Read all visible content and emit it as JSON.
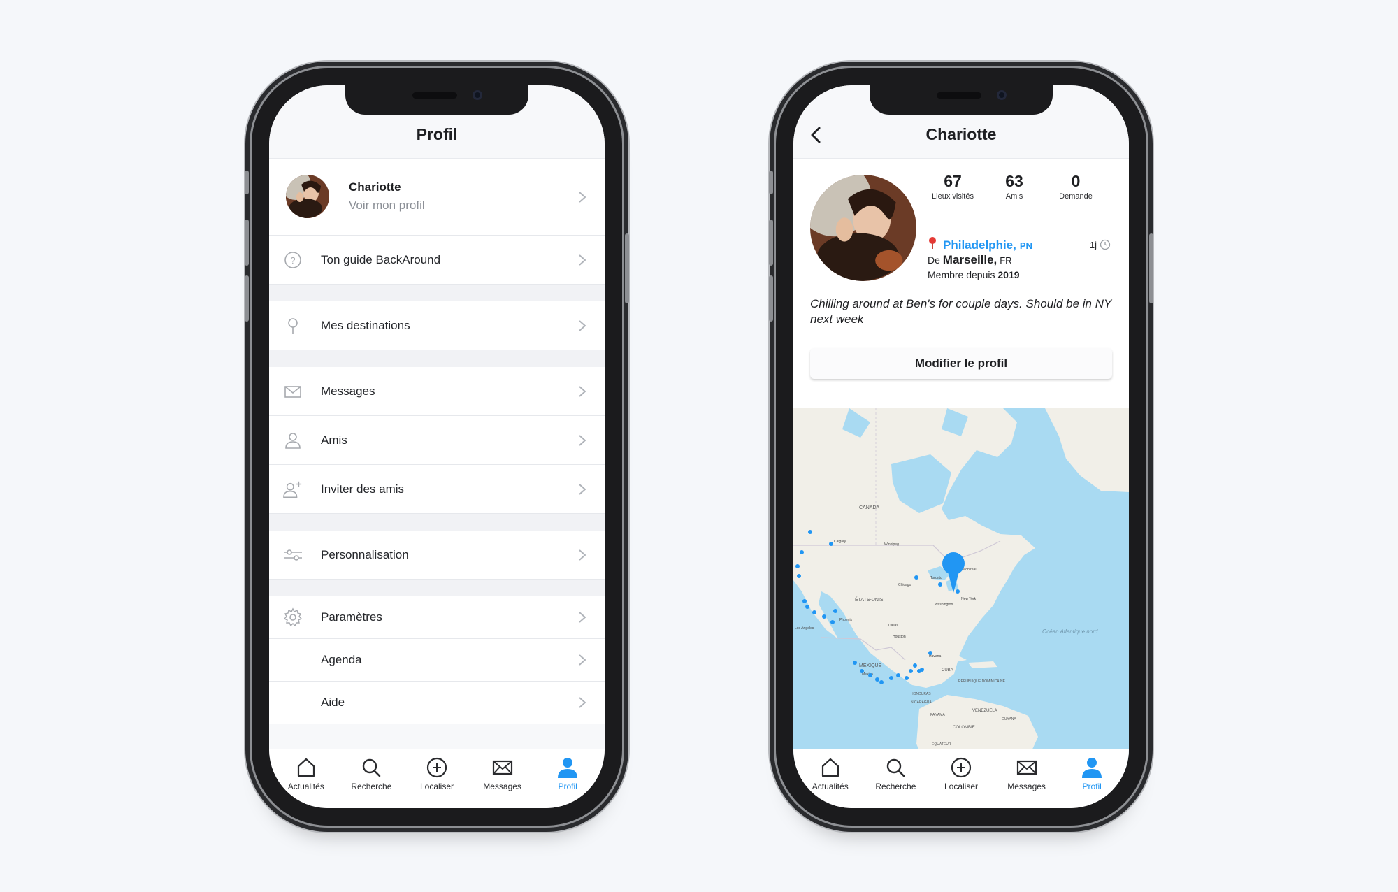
{
  "left_screen": {
    "header": {
      "title": "Profil"
    },
    "profile_row": {
      "name": "Chariotte",
      "subtitle": "Voir mon profil"
    },
    "menu": [
      {
        "label": "Ton guide BackAround",
        "icon": "help-circle-icon"
      },
      {
        "label": "Mes destinations",
        "icon": "pin-icon"
      },
      {
        "label": "Messages",
        "icon": "envelope-icon"
      },
      {
        "label": "Amis",
        "icon": "person-icon"
      },
      {
        "label": "Inviter des amis",
        "icon": "person-add-icon"
      },
      {
        "label": "Personnalisation",
        "icon": "sliders-icon"
      },
      {
        "label": "Paramètres",
        "icon": "gear-icon"
      },
      {
        "label": "Agenda",
        "icon": ""
      },
      {
        "label": "Aide",
        "icon": ""
      }
    ]
  },
  "right_screen": {
    "header": {
      "title": "Chariotte"
    },
    "stats": [
      {
        "value": "67",
        "label": "Lieux visités"
      },
      {
        "value": "63",
        "label": "Amis"
      },
      {
        "value": "0",
        "label": "Demande"
      }
    ],
    "location": {
      "city": "Philadelphie,",
      "region": "PN",
      "time_ago": "1j"
    },
    "origin": {
      "prefix": "De",
      "city": "Marseille,",
      "country": "FR"
    },
    "member_since": {
      "label": "Membre depuis",
      "year": "2019"
    },
    "status": "Chilling around at Ben's for couple days. Should be in NY next week",
    "edit_button": "Modifier le profil",
    "map_labels": {
      "canada": "CANADA",
      "usa": "ÉTATS-UNIS",
      "mexique": "MEXIQUE",
      "cuba": "CUBA",
      "rep_dom": "RÉPUBLIQUE DOMINICAINE",
      "honduras": "HONDURAS",
      "nicaragua": "NICARAGUA",
      "panama": "PANAMA",
      "venezuela": "VENEZUELA",
      "guyana": "GUYANA",
      "colombie": "COLOMBIE",
      "equateur": "ÉQUATEUR",
      "ocean": "Océan Atlantique nord",
      "new_york": "New York",
      "chicago": "Chicago",
      "toronto": "Toronto",
      "washington": "Washington",
      "montreal": "Montréal",
      "dallas": "Dallas",
      "houston": "Houston",
      "phoenix": "Phoenix",
      "los_angeles": "Los Angeles",
      "calgary": "Calgary",
      "winnipeg": "Winnipeg",
      "mexico": "Mexico",
      "havana": "Havana"
    }
  },
  "tabbar": [
    {
      "label": "Actualités",
      "icon": "home-icon"
    },
    {
      "label": "Recherche",
      "icon": "search-icon"
    },
    {
      "label": "Localiser",
      "icon": "plus-circle-icon"
    },
    {
      "label": "Messages",
      "icon": "envelope-icon"
    },
    {
      "label": "Profil",
      "icon": "profile-icon",
      "active": true
    }
  ],
  "colors": {
    "accent": "#2196f3",
    "map_water": "#a9daf2",
    "map_land": "#f1efe8",
    "pin_red": "#e53935"
  }
}
